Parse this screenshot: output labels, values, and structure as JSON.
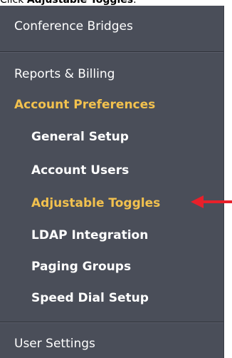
{
  "caption": {
    "prefix": "Click ",
    "target": "Adjustable Toggles",
    "suffix": "."
  },
  "menu": {
    "top_item": "Conference Bridges",
    "items": [
      {
        "label": "Reports & Billing",
        "level": "top",
        "active": false
      },
      {
        "label": "Account Preferences",
        "level": "top",
        "active": true
      },
      {
        "label": "General Setup",
        "level": "sub",
        "active": false
      },
      {
        "label": "Account Users",
        "level": "sub",
        "active": false
      },
      {
        "label": "Adjustable Toggles",
        "level": "sub",
        "active": true
      },
      {
        "label": "LDAP Integration",
        "level": "sub",
        "active": false
      },
      {
        "label": "Paging Groups",
        "level": "sub",
        "active": false
      },
      {
        "label": "Speed Dial Setup",
        "level": "sub",
        "active": false
      }
    ],
    "bottom_item": "User Settings"
  },
  "colors": {
    "menu_bg": "#4a4e59",
    "active": "#f2c14e",
    "arrow": "#e8202a"
  },
  "annotation": {
    "icon": "arrow-left-icon"
  }
}
